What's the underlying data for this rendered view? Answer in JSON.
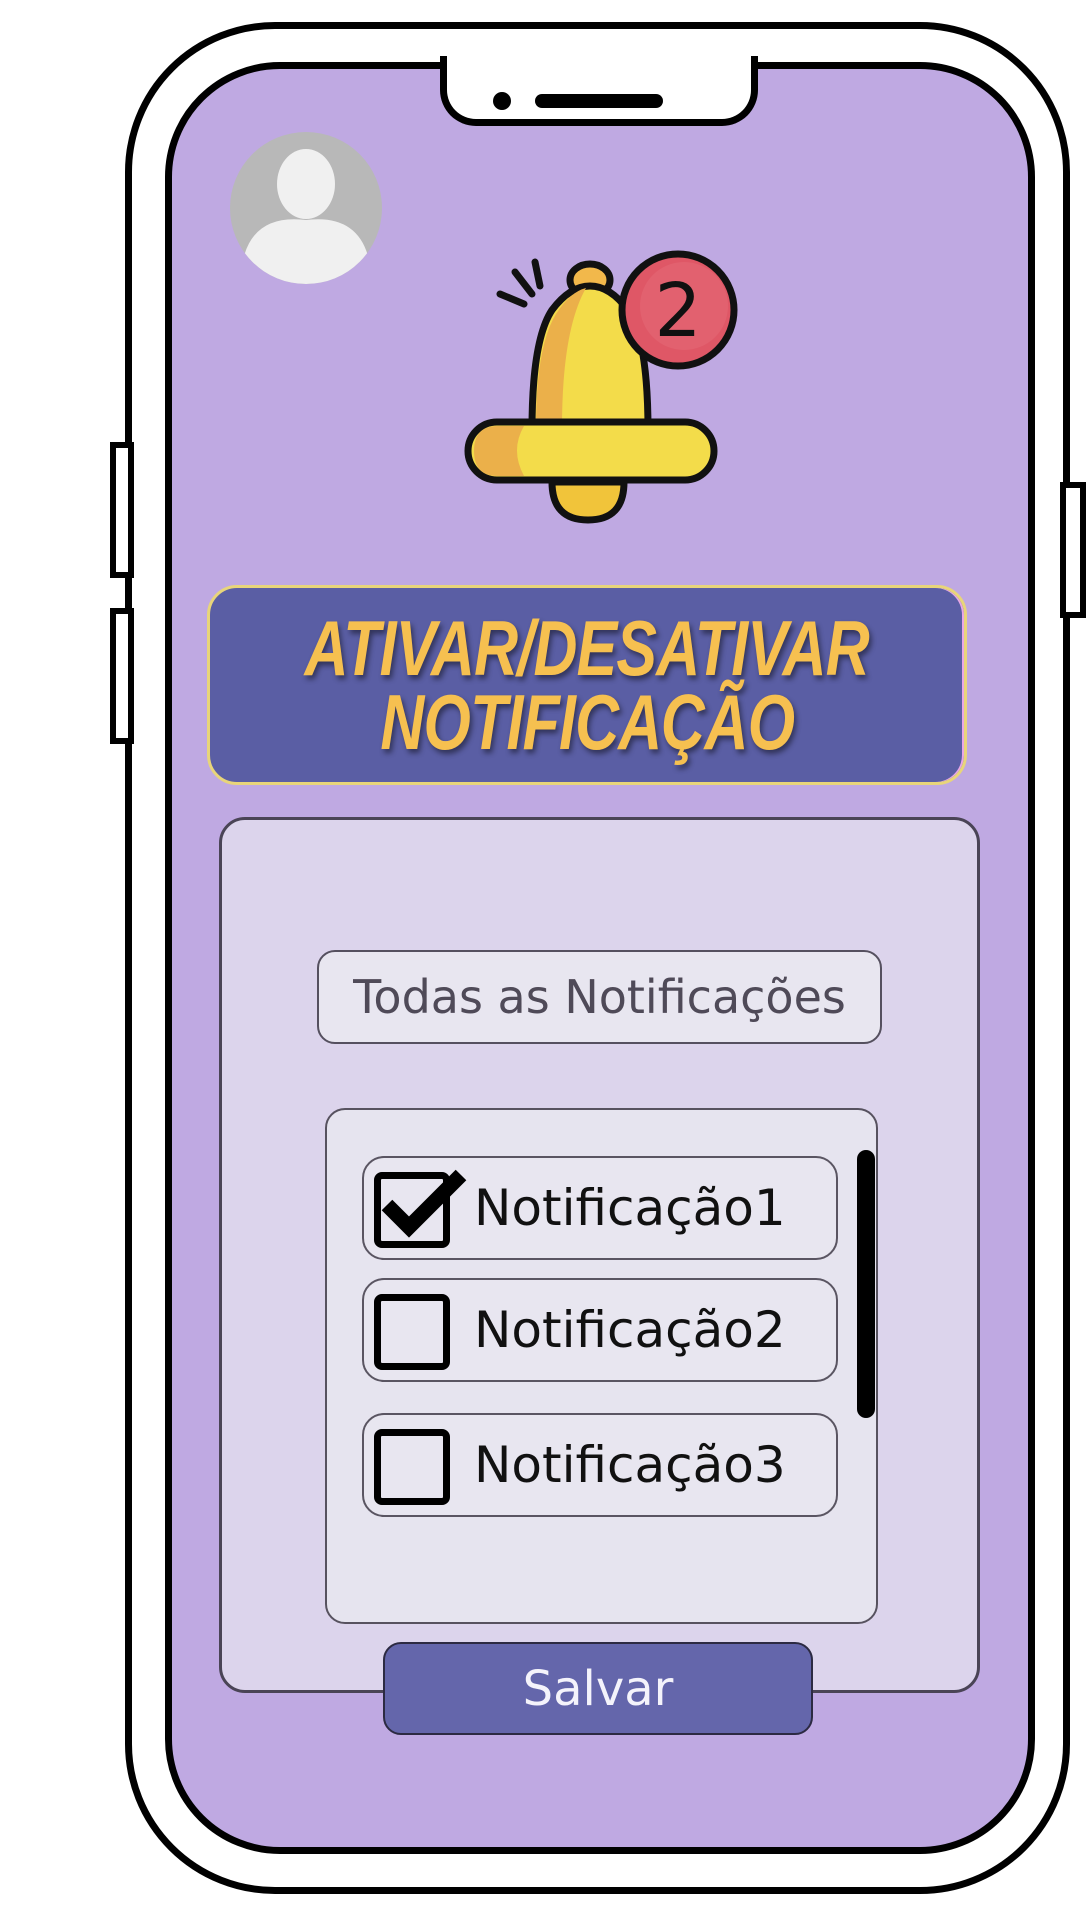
{
  "header": {
    "title_line1": "ATIVAR/DESATIVAR",
    "title_line2": "NOTIFICAÇÃO",
    "notification_badge": "2"
  },
  "filter": {
    "selected": "Todas as Notificações"
  },
  "notifications": [
    {
      "label": "Notificação1",
      "checked": true
    },
    {
      "label": "Notificação2",
      "checked": false
    },
    {
      "label": "Notificação3",
      "checked": false
    }
  ],
  "actions": {
    "save_label": "Salvar"
  },
  "icons": {
    "avatar": "user-avatar-icon",
    "bell": "bell-icon",
    "check": "check-icon"
  },
  "colors": {
    "screen_bg": "#bfa9e2",
    "title_bg": "#5a5ea4",
    "title_text": "#f6c050",
    "button_bg": "#6466ab",
    "badge": "#e05a6a"
  }
}
